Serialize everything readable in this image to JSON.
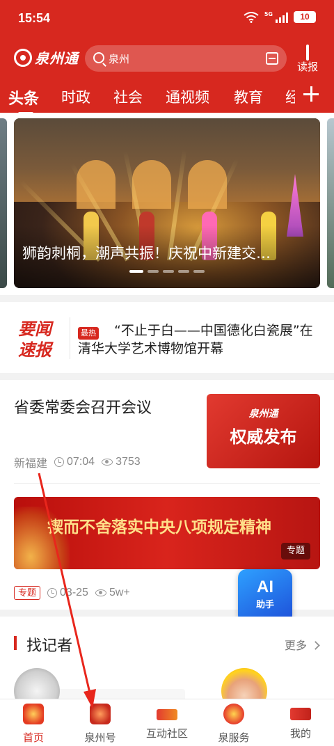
{
  "status_bar": {
    "time": "15:54",
    "network": "5G",
    "battery": "10"
  },
  "header": {
    "logo_text": "泉州通",
    "search_text": "泉州",
    "reader_label": "读报"
  },
  "tabs": [
    {
      "label": "头条",
      "active": true
    },
    {
      "label": "时政",
      "active": false
    },
    {
      "label": "社会",
      "active": false
    },
    {
      "label": "通视频",
      "active": false
    },
    {
      "label": "教育",
      "active": false
    },
    {
      "label": "经",
      "active": false
    }
  ],
  "banner": {
    "caption": "狮韵刺桐，潮声共振！庆祝中新建交…",
    "slide_count": 5,
    "active_slide": 0
  },
  "flash": {
    "label_line1": "要闻",
    "label_line2": "速报",
    "badge": "最热",
    "text": "“不止于白——中国德化白瓷展”在清华大学艺术博物馆开幕"
  },
  "feed": {
    "item1": {
      "title": "省委常委会召开会议",
      "source": "新福建",
      "time": "07:04",
      "views": "3753",
      "thumb_logo": "泉州通",
      "thumb_text": "权威发布"
    },
    "item2": {
      "banner_text": "锲而不舍落实中央八项规定精神",
      "banner_tag": "专题",
      "tag": "专题",
      "date": "03-25",
      "views": "5w+"
    }
  },
  "ai_helper": {
    "line1": "AI",
    "line2": "助手"
  },
  "reporter": {
    "title": "找记者",
    "more": "更多"
  },
  "bottom_nav": [
    {
      "label": "首页",
      "icon": "home-festive-icon",
      "active": true
    },
    {
      "label": "泉州号",
      "icon": "quanzhou-account-icon",
      "active": false
    },
    {
      "label": "互动社区",
      "icon": "community-icon",
      "active": false
    },
    {
      "label": "泉服务",
      "icon": "service-icon",
      "active": false
    },
    {
      "label": "我的",
      "icon": "profile-icon",
      "active": false
    }
  ],
  "colors": {
    "brand_red": "#d7281f",
    "annotation_arrow": "#e8261c"
  }
}
